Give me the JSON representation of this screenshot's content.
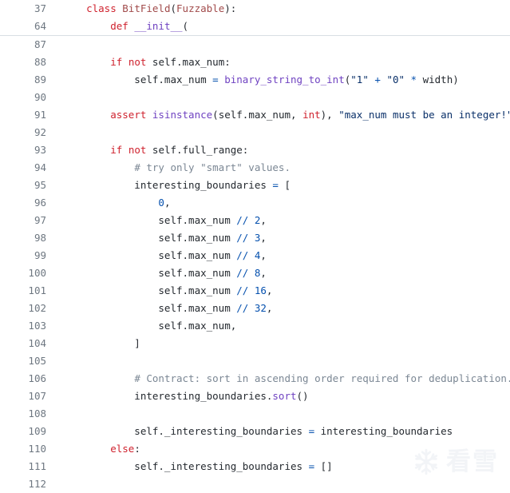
{
  "viewer": {
    "name": "code-file-viewer",
    "language": "python",
    "background": "#ffffff",
    "gutter_color": "#6e7781",
    "divider_color": "#d8dee4"
  },
  "palette": {
    "keyword": "#cf222e",
    "function": "#6f42c1",
    "class_name": "#a14b4b",
    "string": "#0a3069",
    "number": "#0550ae",
    "operator": "#0550ae",
    "comment": "#7b8794",
    "plain": "#24292f"
  },
  "sticky_header": {
    "rows": [
      {
        "number": "37",
        "tokens": [
          {
            "text": "    ",
            "kind": "pl"
          },
          {
            "text": "class",
            "kind": "kw"
          },
          {
            "text": " ",
            "kind": "pl"
          },
          {
            "text": "BitField",
            "kind": "cls"
          },
          {
            "text": "(",
            "kind": "pl"
          },
          {
            "text": "Fuzzable",
            "kind": "cls"
          },
          {
            "text": "):",
            "kind": "pl"
          }
        ]
      },
      {
        "number": "64",
        "tokens": [
          {
            "text": "        ",
            "kind": "pl"
          },
          {
            "text": "def",
            "kind": "kw"
          },
          {
            "text": " ",
            "kind": "pl"
          },
          {
            "text": "__init__",
            "kind": "fn"
          },
          {
            "text": "(",
            "kind": "pl"
          }
        ]
      }
    ]
  },
  "code_rows": [
    {
      "number": "87",
      "tokens": []
    },
    {
      "number": "88",
      "tokens": [
        {
          "text": "        ",
          "kind": "pl"
        },
        {
          "text": "if",
          "kind": "kw"
        },
        {
          "text": " ",
          "kind": "pl"
        },
        {
          "text": "not",
          "kind": "kw"
        },
        {
          "text": " self.max_num:",
          "kind": "pl"
        }
      ]
    },
    {
      "number": "89",
      "tokens": [
        {
          "text": "            self.max_num ",
          "kind": "pl"
        },
        {
          "text": "=",
          "kind": "op"
        },
        {
          "text": " ",
          "kind": "pl"
        },
        {
          "text": "binary_string_to_int",
          "kind": "fn"
        },
        {
          "text": "(",
          "kind": "pl"
        },
        {
          "text": "\"1\"",
          "kind": "str"
        },
        {
          "text": " ",
          "kind": "pl"
        },
        {
          "text": "+",
          "kind": "op"
        },
        {
          "text": " ",
          "kind": "pl"
        },
        {
          "text": "\"0\"",
          "kind": "str"
        },
        {
          "text": " ",
          "kind": "pl"
        },
        {
          "text": "*",
          "kind": "op"
        },
        {
          "text": " width)",
          "kind": "pl"
        }
      ]
    },
    {
      "number": "90",
      "tokens": []
    },
    {
      "number": "91",
      "tokens": [
        {
          "text": "        ",
          "kind": "pl"
        },
        {
          "text": "assert",
          "kind": "kw"
        },
        {
          "text": " ",
          "kind": "pl"
        },
        {
          "text": "isinstance",
          "kind": "fn"
        },
        {
          "text": "(self.max_num, ",
          "kind": "pl"
        },
        {
          "text": "int",
          "kind": "bi"
        },
        {
          "text": "), ",
          "kind": "pl"
        },
        {
          "text": "\"max_num must be an integer!\"",
          "kind": "str"
        }
      ]
    },
    {
      "number": "92",
      "tokens": []
    },
    {
      "number": "93",
      "tokens": [
        {
          "text": "        ",
          "kind": "pl"
        },
        {
          "text": "if",
          "kind": "kw"
        },
        {
          "text": " ",
          "kind": "pl"
        },
        {
          "text": "not",
          "kind": "kw"
        },
        {
          "text": " self.full_range:",
          "kind": "pl"
        }
      ]
    },
    {
      "number": "94",
      "tokens": [
        {
          "text": "            ",
          "kind": "pl"
        },
        {
          "text": "# try only \"smart\" values.",
          "kind": "cmt"
        }
      ]
    },
    {
      "number": "95",
      "tokens": [
        {
          "text": "            interesting_boundaries ",
          "kind": "pl"
        },
        {
          "text": "=",
          "kind": "op"
        },
        {
          "text": " [",
          "kind": "pl"
        }
      ]
    },
    {
      "number": "96",
      "tokens": [
        {
          "text": "                ",
          "kind": "pl"
        },
        {
          "text": "0",
          "kind": "num"
        },
        {
          "text": ",",
          "kind": "pl"
        }
      ]
    },
    {
      "number": "97",
      "tokens": [
        {
          "text": "                self.max_num ",
          "kind": "pl"
        },
        {
          "text": "//",
          "kind": "op"
        },
        {
          "text": " ",
          "kind": "pl"
        },
        {
          "text": "2",
          "kind": "num"
        },
        {
          "text": ",",
          "kind": "pl"
        }
      ]
    },
    {
      "number": "98",
      "tokens": [
        {
          "text": "                self.max_num ",
          "kind": "pl"
        },
        {
          "text": "//",
          "kind": "op"
        },
        {
          "text": " ",
          "kind": "pl"
        },
        {
          "text": "3",
          "kind": "num"
        },
        {
          "text": ",",
          "kind": "pl"
        }
      ]
    },
    {
      "number": "99",
      "tokens": [
        {
          "text": "                self.max_num ",
          "kind": "pl"
        },
        {
          "text": "//",
          "kind": "op"
        },
        {
          "text": " ",
          "kind": "pl"
        },
        {
          "text": "4",
          "kind": "num"
        },
        {
          "text": ",",
          "kind": "pl"
        }
      ]
    },
    {
      "number": "100",
      "tokens": [
        {
          "text": "                self.max_num ",
          "kind": "pl"
        },
        {
          "text": "//",
          "kind": "op"
        },
        {
          "text": " ",
          "kind": "pl"
        },
        {
          "text": "8",
          "kind": "num"
        },
        {
          "text": ",",
          "kind": "pl"
        }
      ]
    },
    {
      "number": "101",
      "tokens": [
        {
          "text": "                self.max_num ",
          "kind": "pl"
        },
        {
          "text": "//",
          "kind": "op"
        },
        {
          "text": " ",
          "kind": "pl"
        },
        {
          "text": "16",
          "kind": "num"
        },
        {
          "text": ",",
          "kind": "pl"
        }
      ]
    },
    {
      "number": "102",
      "tokens": [
        {
          "text": "                self.max_num ",
          "kind": "pl"
        },
        {
          "text": "//",
          "kind": "op"
        },
        {
          "text": " ",
          "kind": "pl"
        },
        {
          "text": "32",
          "kind": "num"
        },
        {
          "text": ",",
          "kind": "pl"
        }
      ]
    },
    {
      "number": "103",
      "tokens": [
        {
          "text": "                self.max_num,",
          "kind": "pl"
        }
      ]
    },
    {
      "number": "104",
      "tokens": [
        {
          "text": "            ]",
          "kind": "pl"
        }
      ]
    },
    {
      "number": "105",
      "tokens": []
    },
    {
      "number": "106",
      "tokens": [
        {
          "text": "            ",
          "kind": "pl"
        },
        {
          "text": "# Contract: sort in ascending order required for deduplication.",
          "kind": "cmt"
        }
      ]
    },
    {
      "number": "107",
      "tokens": [
        {
          "text": "            interesting_boundaries.",
          "kind": "pl"
        },
        {
          "text": "sort",
          "kind": "fn"
        },
        {
          "text": "()",
          "kind": "pl"
        }
      ]
    },
    {
      "number": "108",
      "tokens": []
    },
    {
      "number": "109",
      "tokens": [
        {
          "text": "            self._interesting_boundaries ",
          "kind": "pl"
        },
        {
          "text": "=",
          "kind": "op"
        },
        {
          "text": " interesting_boundaries",
          "kind": "pl"
        }
      ]
    },
    {
      "number": "110",
      "tokens": [
        {
          "text": "        ",
          "kind": "pl"
        },
        {
          "text": "else",
          "kind": "kw"
        },
        {
          "text": ":",
          "kind": "pl"
        }
      ]
    },
    {
      "number": "111",
      "tokens": [
        {
          "text": "            self._interesting_boundaries ",
          "kind": "pl"
        },
        {
          "text": "=",
          "kind": "op"
        },
        {
          "text": " []",
          "kind": "pl"
        }
      ]
    },
    {
      "number": "112",
      "tokens": []
    }
  ],
  "watermark": {
    "icon": "snowflake-icon",
    "text": "看雪",
    "color": "#f2f4f7"
  }
}
